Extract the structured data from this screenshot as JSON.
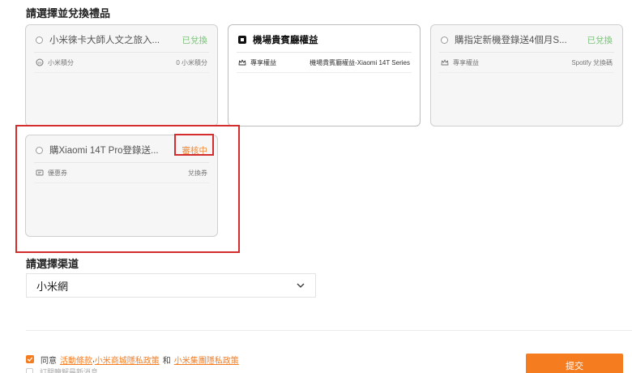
{
  "section_reward": {
    "title": "請選擇並兌換禮品"
  },
  "cards": [
    {
      "title": "小米徠卡大師人文之旅入...",
      "status": "已兌換",
      "row_label": "小米積分",
      "row_value": "0 小米積分",
      "icon": "points-icon"
    },
    {
      "title": "機場貴賓廳權益",
      "status": "",
      "row_label": "專享權益",
      "row_value": "機場貴賓廳權益-Xiaomi 14T Series",
      "icon": "crown-icon"
    },
    {
      "title": "購指定新機登錄送4個月S...",
      "status": "已兌換",
      "row_label": "專享權益",
      "row_value": "Spotify 兌換碼",
      "icon": "crown-icon"
    },
    {
      "title": "購Xiaomi 14T Pro登錄送...",
      "status": "審核中",
      "row_label": "優惠券",
      "row_value": "兌換券",
      "icon": "coupon-icon"
    }
  ],
  "section_channel": {
    "title": "請選擇渠道",
    "selected": "小米網"
  },
  "agreement": {
    "prefix": "同意",
    "link1": "活動條款",
    "comma": ",",
    "link2": "小米商城隱私政策",
    "and": "和",
    "link3": "小米集團隱私政策",
    "subscribe": "訂閱瞭解最新消息"
  },
  "submit": {
    "label": "提交"
  },
  "colors": {
    "accent": "#f57c1f",
    "redeemed": "#7cc27c",
    "review": "#f08c38",
    "highlight": "#d32d2d"
  }
}
